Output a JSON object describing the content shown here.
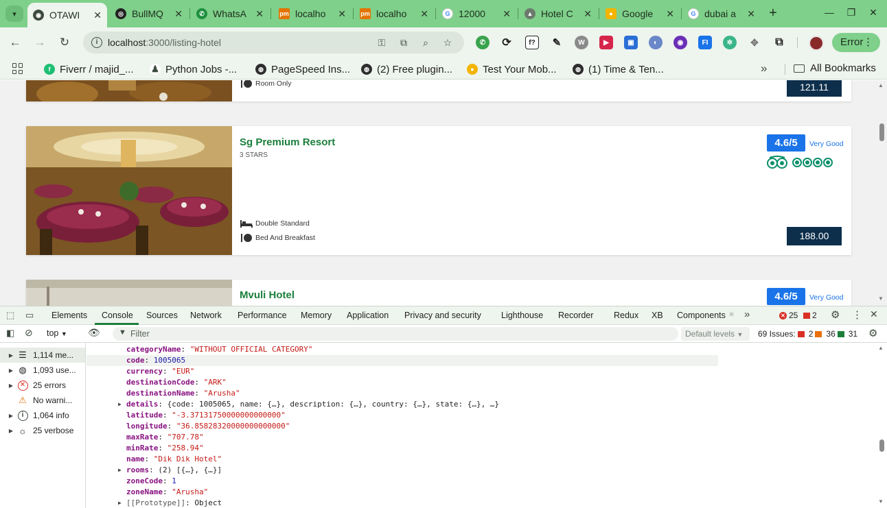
{
  "browser": {
    "tabs": [
      {
        "label": "OTAWI",
        "active": true
      },
      {
        "label": "BullMQ"
      },
      {
        "label": "WhatsA"
      },
      {
        "label": "localho"
      },
      {
        "label": "localho"
      },
      {
        "label": "12000"
      },
      {
        "label": "Hotel C"
      },
      {
        "label": "Google"
      },
      {
        "label": "dubai a"
      }
    ],
    "url_host": "localhost",
    "url_path": ":3000/listing-hotel",
    "error_label": "Error",
    "bookmarks": [
      {
        "label": "Fiverr / majid_..."
      },
      {
        "label": "Python Jobs -..."
      },
      {
        "label": "PageSpeed Ins..."
      },
      {
        "label": "(2) Free plugin..."
      },
      {
        "label": "Test Your Mob..."
      },
      {
        "label": "(1) Time & Ten..."
      }
    ],
    "all_bookmarks_label": "All Bookmarks"
  },
  "listing": {
    "hotels": [
      {
        "name": "",
        "stars": "",
        "features": [
          "Room Only"
        ],
        "price": "121.11"
      },
      {
        "name": "Sg Premium Resort",
        "stars": "3 STARS",
        "rating": "4.6/5",
        "rating_text": "Very Good",
        "features": [
          "Double Standard",
          "Bed And Breakfast"
        ],
        "price": "188.00"
      },
      {
        "name": "Mvuli Hotel",
        "rating": "4.6/5",
        "rating_text": "Very Good"
      }
    ]
  },
  "devtools": {
    "tabs": [
      "Elements",
      "Console",
      "Sources",
      "Network",
      "Performance",
      "Memory",
      "Application",
      "Privacy and security",
      "Lighthouse",
      "Recorder",
      "Redux",
      "XB",
      "Components"
    ],
    "error_count": "25",
    "warning_count": "2",
    "context": "top",
    "filter_placeholder": "Filter",
    "levels_label": "Default levels",
    "issues_label": "69 Issues:",
    "issues_errors": "2",
    "issues_warnings": "36",
    "issues_info": "31",
    "sidebar": [
      {
        "label": "1,114 me..."
      },
      {
        "label": "1,093 use..."
      },
      {
        "label": "25 errors"
      },
      {
        "label": "No warni..."
      },
      {
        "label": "1,064 info"
      },
      {
        "label": "25 verbose"
      }
    ],
    "console_lines": [
      {
        "key": "categoryName",
        "value": "\"WITHOUT OFFICIAL CATEGORY\"",
        "type": "s"
      },
      {
        "key": "code",
        "value": "1005065",
        "type": "n"
      },
      {
        "key": "currency",
        "value": "\"EUR\"",
        "type": "s"
      },
      {
        "key": "destinationCode",
        "value": "\"ARK\"",
        "type": "s"
      },
      {
        "key": "destinationName",
        "value": "\"Arusha\"",
        "type": "s"
      },
      {
        "key": "details",
        "value": "{code: 1005065, name: {…}, description: {…}, country: {…}, state: {…}, …}",
        "type": "o"
      },
      {
        "key": "latitude",
        "value": "\"-3.37131750000000000000\"",
        "type": "s"
      },
      {
        "key": "longitude",
        "value": "\"36.85828320000000000000\"",
        "type": "s"
      },
      {
        "key": "maxRate",
        "value": "\"707.78\"",
        "type": "s"
      },
      {
        "key": "minRate",
        "value": "\"258.94\"",
        "type": "s"
      },
      {
        "key": "name",
        "value": "\"Dik Dik Hotel\"",
        "type": "s"
      },
      {
        "key": "rooms",
        "value": "(2) [{…}, {…}]",
        "type": "o"
      },
      {
        "key": "zoneCode",
        "value": "1",
        "type": "n"
      },
      {
        "key": "zoneName",
        "value": "\"Arusha\"",
        "type": "s"
      },
      {
        "key": "[[Prototype]]",
        "value": "Object",
        "type": "p"
      }
    ]
  }
}
